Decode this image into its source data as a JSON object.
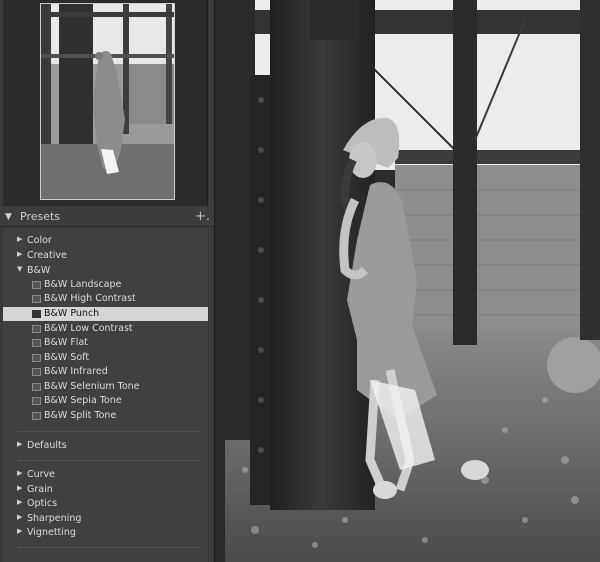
{
  "presets": {
    "title": "Presets",
    "add_symbol": "+.",
    "collapse_symbol": "▼",
    "items": [
      {
        "label": "Color",
        "expanded": false
      },
      {
        "label": "Creative",
        "expanded": false
      },
      {
        "label": "B&W",
        "expanded": true,
        "children": [
          {
            "label": "B&W Landscape"
          },
          {
            "label": "B&W High Contrast"
          },
          {
            "label": "B&W Punch",
            "selected": true
          },
          {
            "label": "B&W Low Contrast"
          },
          {
            "label": "B&W Flat"
          },
          {
            "label": "B&W Soft"
          },
          {
            "label": "B&W Infrared"
          },
          {
            "label": "B&W Selenium Tone"
          },
          {
            "label": "B&W Sepia Tone"
          },
          {
            "label": "B&W Split Tone"
          }
        ]
      },
      {
        "label": "Defaults",
        "expanded": false
      },
      {
        "label": "Curve",
        "expanded": false
      },
      {
        "label": "Grain",
        "expanded": false
      },
      {
        "label": "Optics",
        "expanded": false
      },
      {
        "label": "Sharpening",
        "expanded": false
      },
      {
        "label": "Vignetting",
        "expanded": false
      }
    ]
  },
  "icons": {
    "collapsed_arrow": "▶",
    "expanded_arrow": "▼"
  }
}
